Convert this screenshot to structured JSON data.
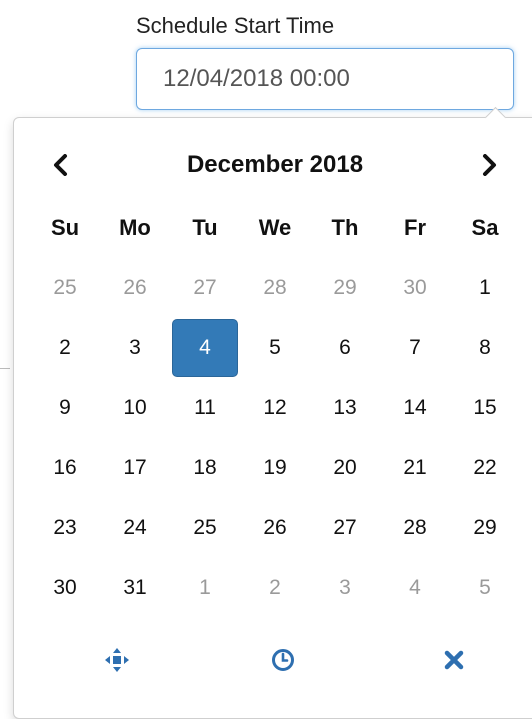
{
  "field": {
    "label": "Schedule Start Time",
    "value": "12/04/2018 00:00"
  },
  "calendar": {
    "month_title": "December 2018",
    "prev_icon": "chevron-left-icon",
    "next_icon": "chevron-right-icon",
    "weekdays": [
      "Su",
      "Mo",
      "Tu",
      "We",
      "Th",
      "Fr",
      "Sa"
    ],
    "weeks": [
      [
        {
          "d": "25",
          "m": "old"
        },
        {
          "d": "26",
          "m": "old"
        },
        {
          "d": "27",
          "m": "old"
        },
        {
          "d": "28",
          "m": "old"
        },
        {
          "d": "29",
          "m": "old"
        },
        {
          "d": "30",
          "m": "old"
        },
        {
          "d": "1",
          "m": "cur"
        }
      ],
      [
        {
          "d": "2",
          "m": "cur"
        },
        {
          "d": "3",
          "m": "cur"
        },
        {
          "d": "4",
          "m": "active"
        },
        {
          "d": "5",
          "m": "cur"
        },
        {
          "d": "6",
          "m": "cur"
        },
        {
          "d": "7",
          "m": "cur"
        },
        {
          "d": "8",
          "m": "cur"
        }
      ],
      [
        {
          "d": "9",
          "m": "cur"
        },
        {
          "d": "10",
          "m": "cur"
        },
        {
          "d": "11",
          "m": "cur"
        },
        {
          "d": "12",
          "m": "cur"
        },
        {
          "d": "13",
          "m": "cur"
        },
        {
          "d": "14",
          "m": "cur"
        },
        {
          "d": "15",
          "m": "cur"
        }
      ],
      [
        {
          "d": "16",
          "m": "cur"
        },
        {
          "d": "17",
          "m": "cur"
        },
        {
          "d": "18",
          "m": "cur"
        },
        {
          "d": "19",
          "m": "cur"
        },
        {
          "d": "20",
          "m": "cur"
        },
        {
          "d": "21",
          "m": "cur"
        },
        {
          "d": "22",
          "m": "cur"
        }
      ],
      [
        {
          "d": "23",
          "m": "cur"
        },
        {
          "d": "24",
          "m": "cur"
        },
        {
          "d": "25",
          "m": "cur"
        },
        {
          "d": "26",
          "m": "cur"
        },
        {
          "d": "27",
          "m": "cur"
        },
        {
          "d": "28",
          "m": "cur"
        },
        {
          "d": "29",
          "m": "cur"
        }
      ],
      [
        {
          "d": "30",
          "m": "cur"
        },
        {
          "d": "31",
          "m": "cur"
        },
        {
          "d": "1",
          "m": "new"
        },
        {
          "d": "2",
          "m": "new"
        },
        {
          "d": "3",
          "m": "new"
        },
        {
          "d": "4",
          "m": "new"
        },
        {
          "d": "5",
          "m": "new"
        }
      ]
    ]
  },
  "toolbar": {
    "today_icon": "crosshairs-icon",
    "time_icon": "clock-icon",
    "clear_icon": "close-icon"
  },
  "colors": {
    "accent": "#337ab7",
    "muted_day": "#9a9a9a",
    "input_border": "#6ea8e0"
  }
}
